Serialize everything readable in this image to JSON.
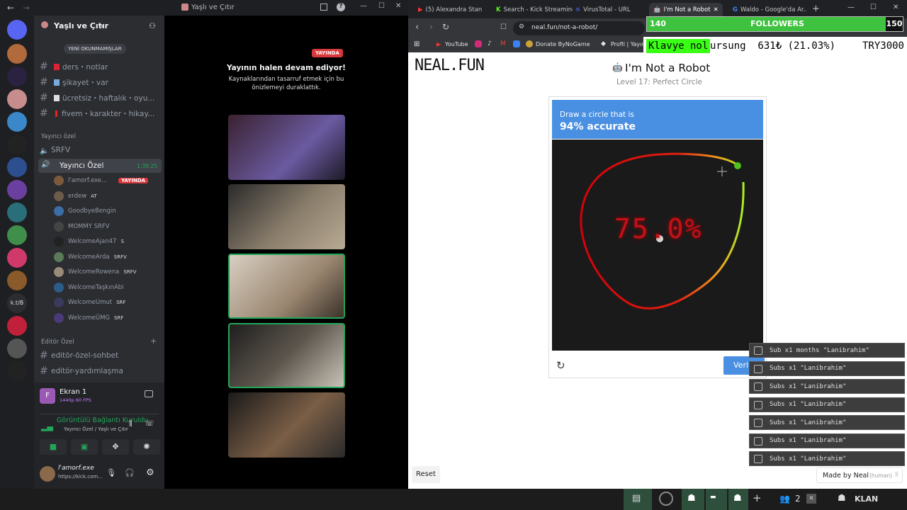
{
  "discord": {
    "window_title": "Yaşlı ve Çıtır",
    "server_name": "Yaşlı ve Çıtır",
    "new_unread": "YENİ OKUNMAMIŞLAR",
    "channels": [
      "ders・notlar",
      "şikayet・var",
      "ücretsiz・haftalık・oyu...",
      "fivem・karakter・hikay..."
    ],
    "streamer_category": "Yayıncı özel",
    "voice_channels": [
      "SRFV",
      "Yayıncı Özel"
    ],
    "voice_timer": "1:39:25",
    "voice_users": [
      {
        "name": "l'amorf.exe...",
        "badge": "YAYINDA"
      },
      {
        "name": "erdew",
        "tag": "AT"
      },
      {
        "name": "GoodbyeBengin",
        "tag": ""
      },
      {
        "name": "MOMMY SRFV",
        "tag": ""
      },
      {
        "name": "WelcomeAjan47",
        "tag": "S"
      },
      {
        "name": "WelcomeArda",
        "tag": "SRFV"
      },
      {
        "name": "WelcomeRowena",
        "tag": "SRFV"
      },
      {
        "name": "WelcomeTaşkınAbi",
        "tag": ""
      },
      {
        "name": "WelcomeUmut",
        "tag": "SRF"
      },
      {
        "name": "WelcomeÜMG",
        "tag": "SRF"
      }
    ],
    "editor_category": "Editör Özel",
    "editor_channels": [
      "editör-özel-sohbet",
      "editör-yardımlaşma"
    ],
    "screen_title": "Ekran 1",
    "screen_quality": "1440p 60 FPS",
    "connection_title": "Görüntülü Bağlantı Kuruldu",
    "connection_sub": "Yayıncı Özel / Yaşlı ve Çıtır",
    "user_name": "l'amorf.exe",
    "user_status": "https://kick.com...",
    "live_badge": "YAYINDA",
    "stream_paused_title": "Yayının halen devam ediyor!",
    "stream_paused_body": "Kaynaklarından tasarruf etmek için bu önizlemeyi duraklattık.",
    "rail_labels": [
      "k.t/B"
    ]
  },
  "browser": {
    "tabs": [
      "(5) Alexandra Stan",
      "Search - Kick Streaming",
      "VirusTotal - URL",
      "I'm Not a Robot",
      "Waldo - Google'da Ar..."
    ],
    "url": "neal.fun/not-a-robot/",
    "bookmarks": [
      "YouTube",
      "Donate ByNoGame",
      "Profil | Yayıncı"
    ],
    "followers": {
      "current": "140",
      "label": "FOLLOWERS",
      "goal": "150",
      "progress": 0.0
    },
    "overlay_text": "Klavye nolursung  631₺ (21.03%)",
    "overlay_typed": "Klavye nol",
    "overlay_rest": "ursung  631₺ (21.03%)",
    "overlay_right": "TRY3000"
  },
  "page": {
    "logo": "NEAL.FUN",
    "title": "I'm Not a Robot",
    "level": "Level 17: Perfect Circle",
    "prompt_line1": "Draw a circle that is",
    "prompt_line2": "94% accurate",
    "score": "75.0%",
    "verify_label": "Verify",
    "reset_label": "Reset",
    "made_by": "Made by Neal",
    "made_by_tag": "(human)"
  },
  "subs": [
    "Sub x1 months \"Lanibrahim\"",
    "Subs x1 \"Lanibrahim\"",
    "Subs x1 \"Lanibrahim\"",
    "Subs x1 \"Lanibrahim\"",
    "Subs x1 \"Lanibrahim\"",
    "Subs x1 \"Lanibrahim\"",
    "Subs x1 \"Lanibrahim\""
  ],
  "taskbar": {
    "count": "2",
    "klan": "KLAN"
  }
}
